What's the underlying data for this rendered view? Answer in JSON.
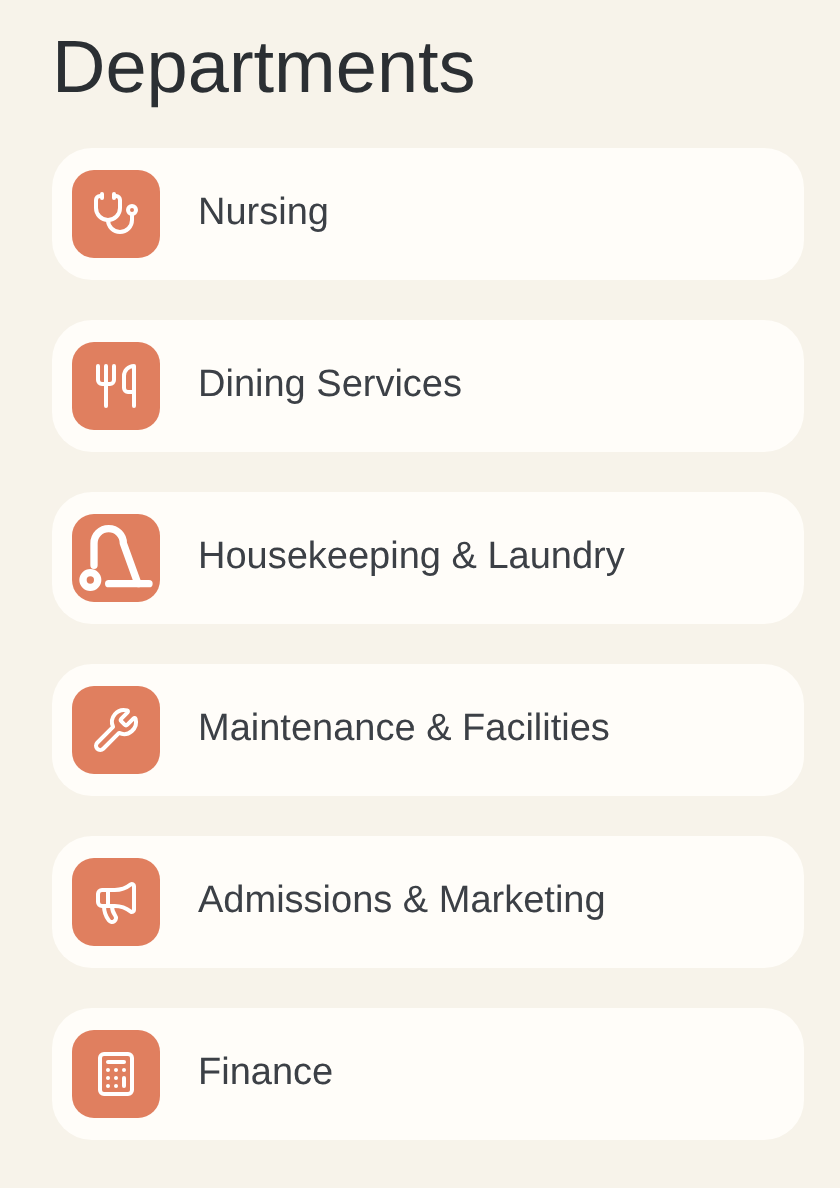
{
  "title": "Departments",
  "departments": [
    {
      "label": "Nursing",
      "kind": "stethoscope"
    },
    {
      "label": "Dining Services",
      "kind": "utensils"
    },
    {
      "label": "Housekeeping & Laundry",
      "kind": "vacuum"
    },
    {
      "label": "Maintenance & Facilities",
      "kind": "wrench"
    },
    {
      "label": "Admissions & Marketing",
      "kind": "megaphone"
    },
    {
      "label": "Finance",
      "kind": "calculator"
    }
  ]
}
